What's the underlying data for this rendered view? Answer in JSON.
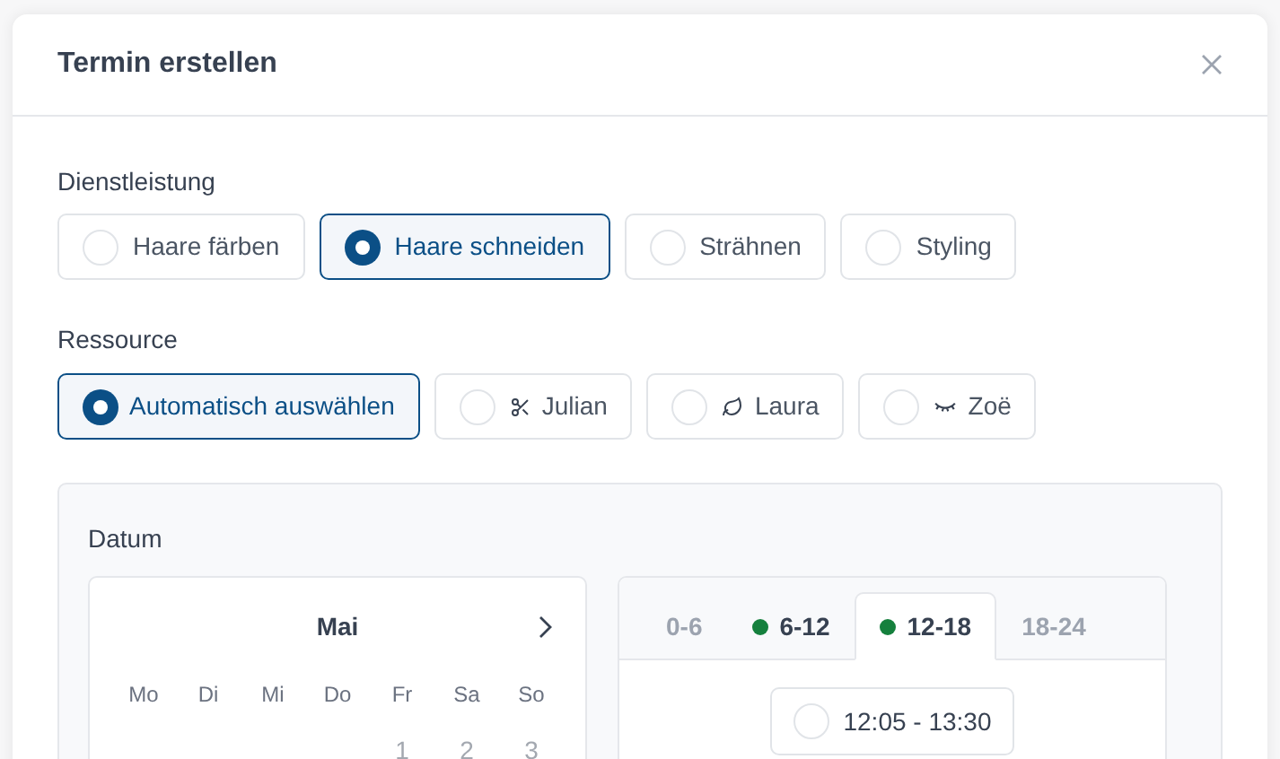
{
  "dialog": {
    "title": "Termin erstellen"
  },
  "service": {
    "label": "Dienstleistung",
    "options": [
      {
        "label": "Haare färben",
        "selected": false
      },
      {
        "label": "Haare schneiden",
        "selected": true
      },
      {
        "label": "Strähnen",
        "selected": false
      },
      {
        "label": "Styling",
        "selected": false
      }
    ]
  },
  "resource": {
    "label": "Ressource",
    "options": [
      {
        "label": "Automatisch auswählen",
        "selected": true,
        "kind": "auto"
      },
      {
        "label": "Julian",
        "selected": false,
        "kind": "person"
      },
      {
        "label": "Laura",
        "selected": false,
        "kind": "person"
      },
      {
        "label": "Zoë",
        "selected": false,
        "kind": "person"
      }
    ]
  },
  "date": {
    "label": "Datum",
    "calendar": {
      "month": "Mai",
      "weekdays": [
        "Mo",
        "Di",
        "Mi",
        "Do",
        "Fr",
        "Sa",
        "So"
      ],
      "days": [
        {
          "label": "1",
          "disabled": true
        },
        {
          "label": "2",
          "disabled": true
        },
        {
          "label": "3",
          "disabled": true
        }
      ]
    },
    "time_tabs": [
      {
        "label": "0-6",
        "selected": false,
        "available": false
      },
      {
        "label": "6-12",
        "selected": false,
        "available": true
      },
      {
        "label": "12-18",
        "selected": true,
        "available": true
      },
      {
        "label": "18-24",
        "selected": false,
        "available": false
      }
    ],
    "slots": [
      {
        "label": "12:05 - 13:30",
        "selected": false
      }
    ]
  }
}
